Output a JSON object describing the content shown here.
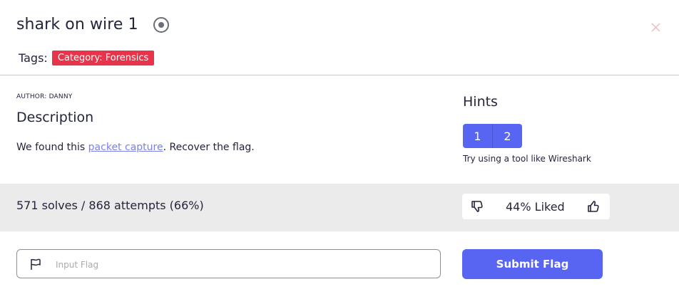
{
  "challenge": {
    "title": "shark on wire 1",
    "tags_label": "Tags:",
    "tags": [
      "Category: Forensics"
    ],
    "author": "AUTHOR: DANNY",
    "description_heading": "Description",
    "description_prefix": "We found this ",
    "description_link": "packet capture",
    "description_suffix": ". Recover the flag."
  },
  "hints": {
    "heading": "Hints",
    "buttons": [
      "1",
      "2"
    ],
    "active_text": "Try using a tool like Wireshark"
  },
  "stats": {
    "solves_text": "571 solves / 868 attempts (66%)",
    "liked_text": "44% Liked"
  },
  "flag_form": {
    "placeholder": "Input Flag",
    "submit_label": "Submit Flag"
  },
  "colors": {
    "accent": "#5865f2",
    "tag_red": "#e8344a",
    "link": "#7b82e6",
    "band": "#ebebeb"
  },
  "icons": {
    "title": "target-icon",
    "close": "close-icon",
    "dislike": "thumbs-down-icon",
    "like": "thumbs-up-icon",
    "flag": "flag-icon"
  }
}
